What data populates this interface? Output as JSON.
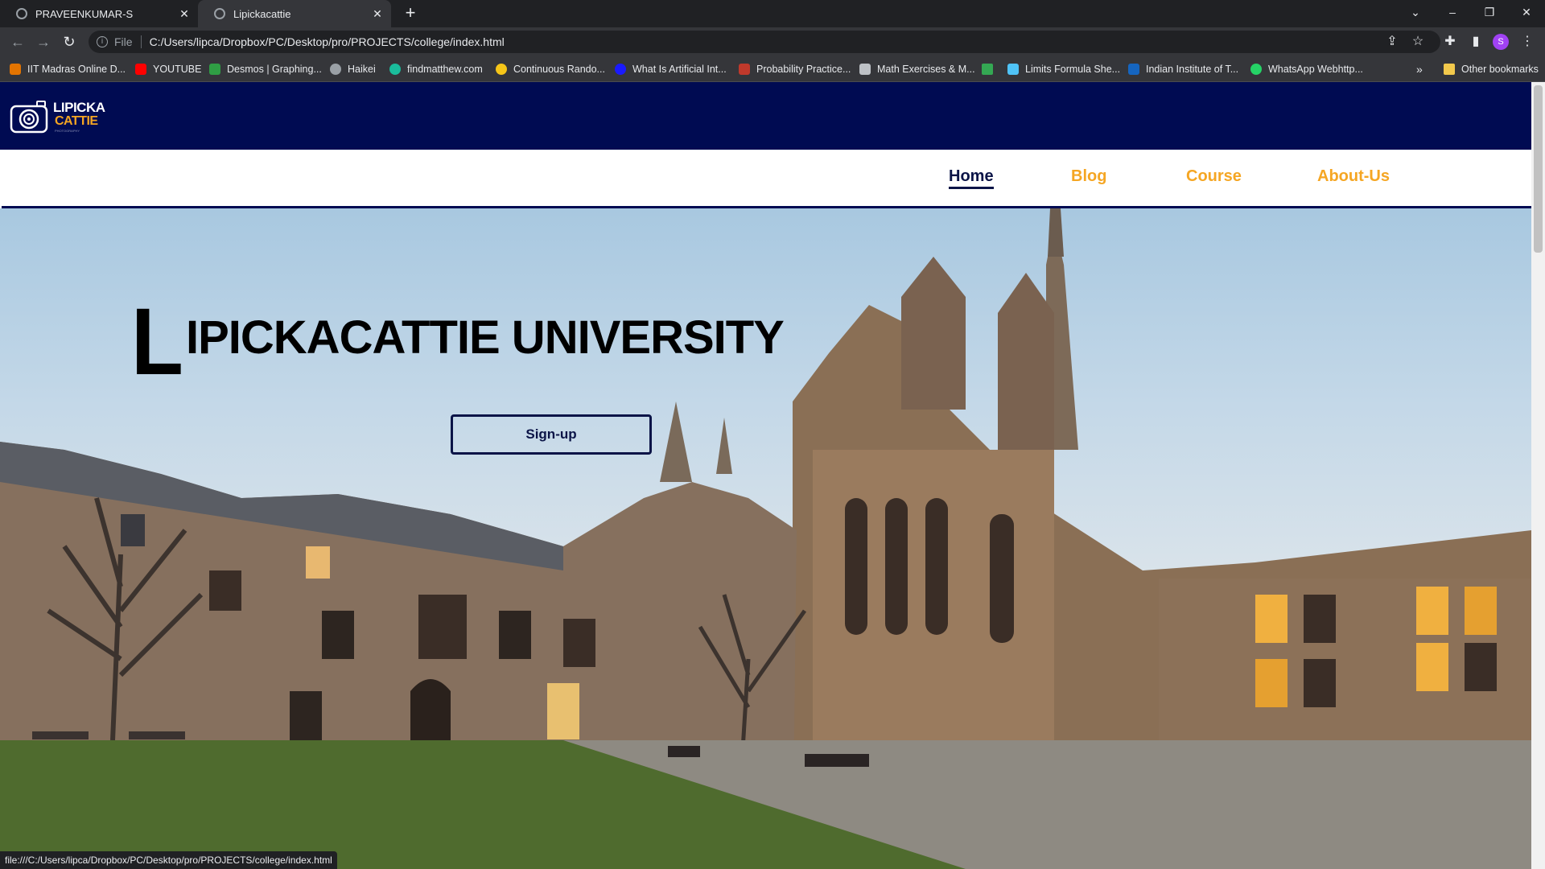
{
  "browser": {
    "tabs": [
      {
        "title": "PRAVEENKUMAR-S"
      },
      {
        "title": "Lipickacattie"
      }
    ],
    "url_scheme": "File",
    "url": "C:/Users/lipca/Dropbox/PC/Desktop/pro/PROJECTS/college/index.html",
    "profile_initial": "S",
    "bookmarks": [
      {
        "label": "IIT Madras Online D...",
        "color": "#e37400"
      },
      {
        "label": "YOUTUBE",
        "color": "#ff0000"
      },
      {
        "label": "Desmos | Graphing...",
        "color": "#2f9e44"
      },
      {
        "label": "Haikei",
        "color": "#9aa0a6"
      },
      {
        "label": "findmatthew.com",
        "color": "#1abc9c"
      },
      {
        "label": "Continuous Rando...",
        "color": "#f5c518"
      },
      {
        "label": "What Is Artificial Int...",
        "color": "#1a1aff"
      },
      {
        "label": "Probability Practice...",
        "color": "#c0392b"
      },
      {
        "label": "Math Exercises & M...",
        "color": "#bdc1c6"
      },
      {
        "label": "",
        "color": "#34a853"
      },
      {
        "label": "Limits Formula She...",
        "color": "#4fc3f7"
      },
      {
        "label": "Indian Institute of T...",
        "color": "#1565c0"
      },
      {
        "label": "WhatsApp Webhttp...",
        "color": "#25d366"
      }
    ],
    "more_bookmarks": "»",
    "other_bookmarks": "Other bookmarks",
    "status_url": "file:///C:/Users/lipca/Dropbox/PC/Desktop/pro/PROJECTS/college/index.html"
  },
  "site": {
    "logo": {
      "line1": "LIPICKA",
      "line2": "CATTIE",
      "line3": "PHOTOGRAPHY"
    },
    "nav": [
      {
        "label": "Home",
        "active": true
      },
      {
        "label": "Blog",
        "active": false
      },
      {
        "label": "Course",
        "active": false
      },
      {
        "label": "About-Us",
        "active": false
      }
    ],
    "hero": {
      "title_initial": "L",
      "title_rest": "IPICKACATTIE UNIVERSITY",
      "signup_label": "Sign-up"
    }
  },
  "colors": {
    "header_bg": "#000b52",
    "accent": "#f5a623",
    "nav_active": "#0b1447"
  }
}
